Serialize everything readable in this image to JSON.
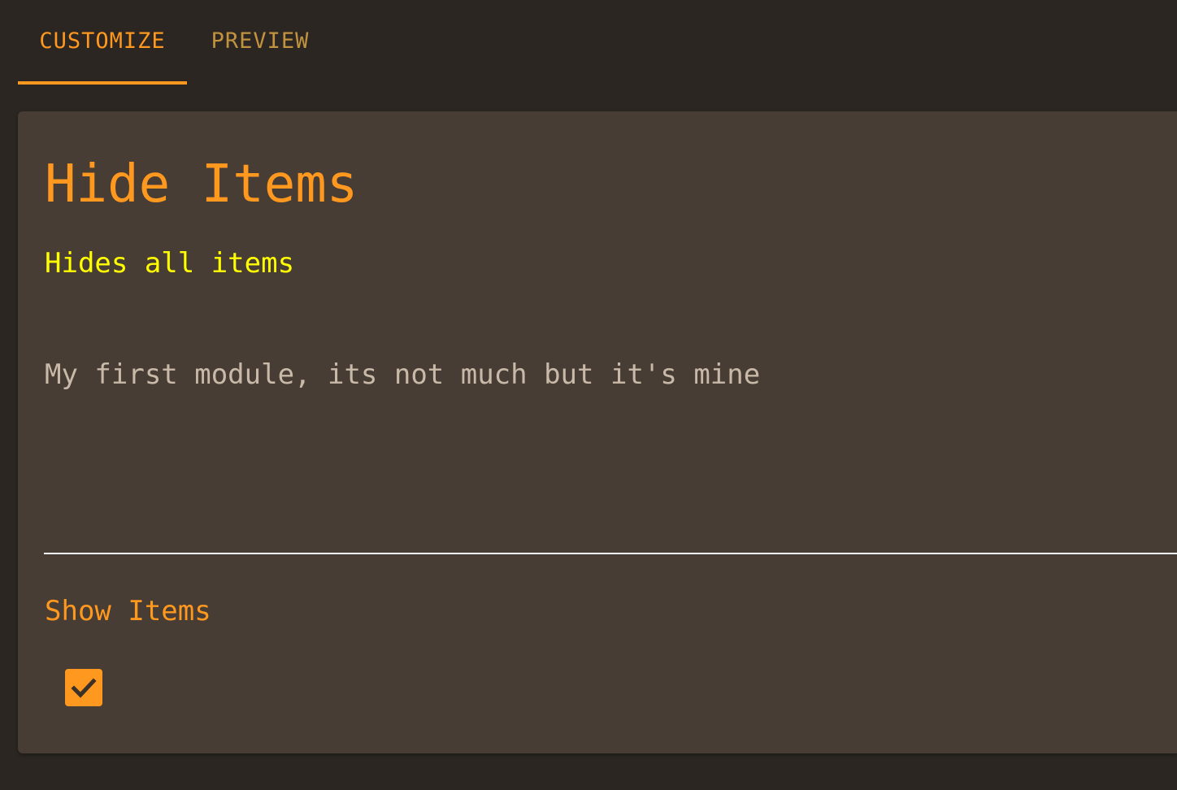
{
  "tabs": [
    {
      "label": "CUSTOMIZE",
      "active": true
    },
    {
      "label": "PREVIEW",
      "active": false
    }
  ],
  "module": {
    "title": "Hide Items",
    "subtitle": "Hides all items",
    "description": "My first module, its not much but it's mine"
  },
  "settings": {
    "show_items": {
      "label": "Show Items",
      "checked": true
    }
  },
  "colors": {
    "background": "#2b2622",
    "card": "#473d34",
    "accent": "#ff981f",
    "inactive_tab": "#c2933f",
    "subtitle": "#ffff00",
    "description": "#c8b9a8"
  },
  "icons": {
    "checkbox_mark": "check-icon"
  }
}
